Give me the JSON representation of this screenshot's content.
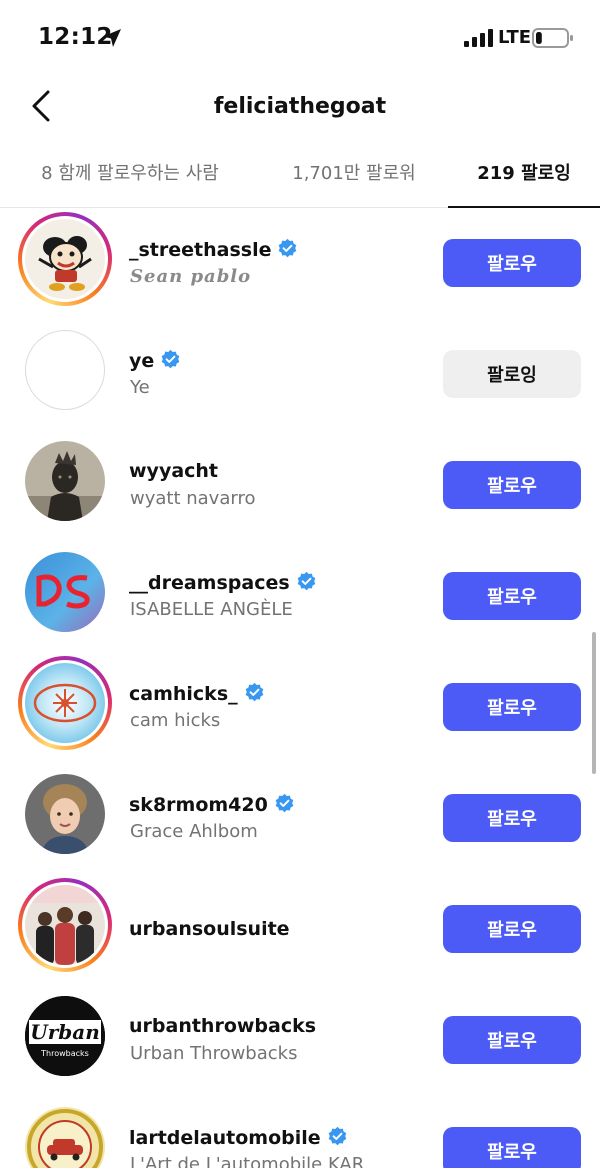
{
  "status_bar": {
    "time": "12:12",
    "network": "LTE",
    "battery_level": 0.2
  },
  "header": {
    "title": "feliciathegoat"
  },
  "tabs": [
    {
      "label": "8 함께 팔로우하는 사람",
      "active": false
    },
    {
      "label": "1,701만 팔로워",
      "active": false
    },
    {
      "label": "219 팔로잉",
      "active": true
    }
  ],
  "users": [
    {
      "username": "_streethassle",
      "full_name": "Sean pablo",
      "verified": true,
      "story_ring": true,
      "button": "팔로우",
      "button_style": "primary",
      "avatar_icon": "cartoon-character-avatar"
    },
    {
      "username": "ye",
      "full_name": "Ye",
      "verified": true,
      "story_ring": false,
      "button": "팔로잉",
      "button_style": "secondary",
      "avatar_icon": "blank-avatar"
    },
    {
      "username": "wyyacht",
      "full_name": "wyatt navarro",
      "verified": false,
      "story_ring": false,
      "button": "팔로우",
      "button_style": "primary",
      "avatar_icon": "statue-avatar"
    },
    {
      "username": "__dreamspaces",
      "full_name": "ISABELLE ANGÈLE",
      "verified": true,
      "story_ring": false,
      "button": "팔로우",
      "button_style": "primary",
      "avatar_icon": "red-logo-avatar"
    },
    {
      "username": "camhicks_",
      "full_name": "cam hicks",
      "verified": true,
      "story_ring": true,
      "button": "팔로우",
      "button_style": "primary",
      "avatar_icon": "star-emblem-avatar"
    },
    {
      "username": "sk8rmom420",
      "full_name": "Grace Ahlbom",
      "verified": true,
      "story_ring": false,
      "button": "팔로우",
      "button_style": "primary",
      "avatar_icon": "child-photo-avatar"
    },
    {
      "username": "urbansoulsuite",
      "full_name": "",
      "verified": false,
      "story_ring": true,
      "button": "팔로우",
      "button_style": "primary",
      "avatar_icon": "group-photo-avatar"
    },
    {
      "username": "urbanthrowbacks",
      "full_name": "Urban Throwbacks",
      "verified": false,
      "story_ring": false,
      "button": "팔로우",
      "button_style": "primary",
      "avatar_icon": "urban-logo-avatar",
      "avatar_text": {
        "main": "Urban",
        "sub": "Throwbacks"
      }
    },
    {
      "username": "lartdelautomobile",
      "full_name": "L'Art de L'automobile KAR",
      "verified": true,
      "story_ring": false,
      "button": "팔로우",
      "button_style": "primary",
      "avatar_icon": "car-badge-avatar"
    }
  ],
  "colors": {
    "follow_button": "#4c5bf5",
    "following_button": "#efeff0",
    "verified": "#3897f0",
    "secondary_text": "#737373"
  }
}
